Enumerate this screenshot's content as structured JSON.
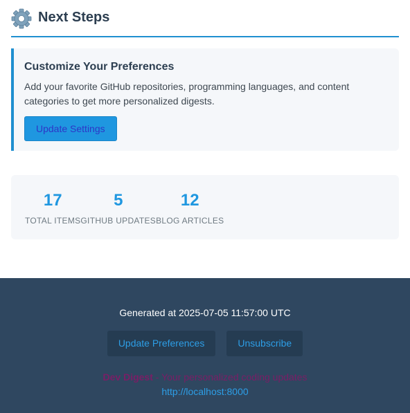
{
  "header": {
    "icon": "gear-icon",
    "title": "Next Steps"
  },
  "preferences": {
    "title": "Customize Your Preferences",
    "description": "Add your favorite GitHub repositories, programming languages, and content categories to get more personalized digests.",
    "button_label": "Update Settings"
  },
  "stats": [
    {
      "value": "17",
      "label": "TOTAL ITEMS"
    },
    {
      "value": "5",
      "label": "GITHUB UPDATES"
    },
    {
      "value": "12",
      "label": "BLOG ARTICLES"
    }
  ],
  "footer": {
    "generated": "Generated at 2025-07-05 11:57:00 UTC",
    "update_preferences": "Update Preferences",
    "unsubscribe": "Unsubscribe",
    "brand": "Dev Digest",
    "tagline": " - Your personalized coding updates",
    "url": "http://localhost:8000"
  },
  "colors": {
    "accent": "#1f97e0",
    "footer_bg": "#2f4760",
    "brand": "#7a1e66"
  }
}
